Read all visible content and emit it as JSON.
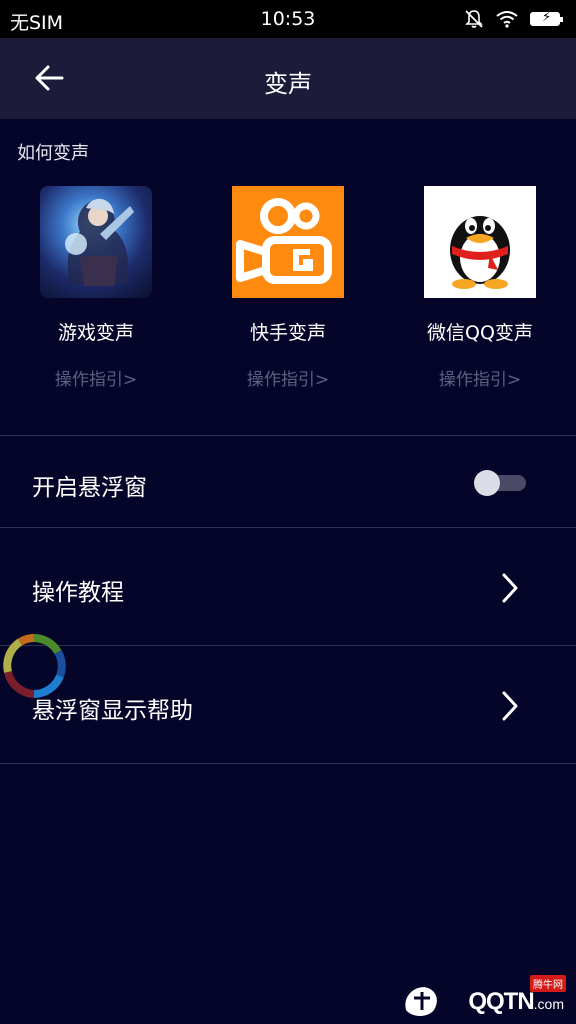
{
  "status_bar": {
    "carrier": "无SIM",
    "time": "10:53"
  },
  "nav": {
    "title": "变声"
  },
  "section": {
    "title": "如何变声"
  },
  "apps": [
    {
      "name": "游戏变声",
      "guide": "操作指引>"
    },
    {
      "name": "快手变声",
      "guide": "操作指引>"
    },
    {
      "name": "微信QQ变声",
      "guide": "操作指引>"
    }
  ],
  "settings": {
    "floating_window": {
      "label": "开启悬浮窗",
      "enabled": false
    },
    "tutorial": {
      "label": "操作教程"
    },
    "floating_help": {
      "label": "悬浮窗显示帮助"
    }
  },
  "watermark": {
    "brand": "QQTN",
    "suffix": ".com",
    "badge": "腾牛网"
  },
  "colors": {
    "background": "#05052a",
    "nav_bar": "#1c1c3a",
    "guide_text": "#5e5e80",
    "divider": "#2f2f52",
    "kuaishou_orange": "#ff8a10"
  }
}
